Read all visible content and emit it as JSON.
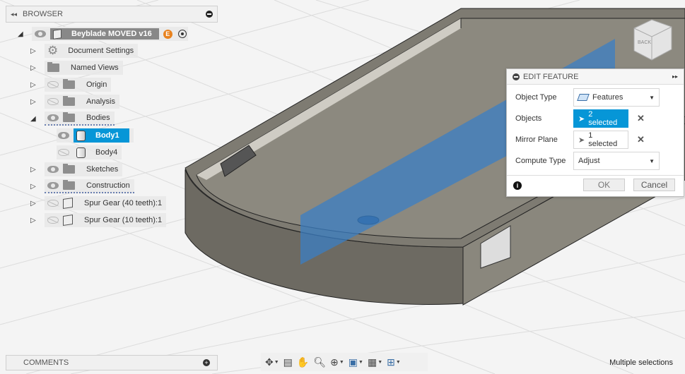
{
  "browser": {
    "title": "BROWSER",
    "root": "Beyblade MOVED v16",
    "root_badge": "E",
    "items": [
      {
        "label": "Document Settings",
        "icon": "gear-icon",
        "visible": null,
        "expander": "collapsed"
      },
      {
        "label": "Named Views",
        "icon": "folder-icon",
        "visible": null,
        "expander": "collapsed"
      },
      {
        "label": "Origin",
        "icon": "folder-icon",
        "visible": false,
        "expander": "collapsed"
      },
      {
        "label": "Analysis",
        "icon": "folder-icon",
        "visible": false,
        "expander": "collapsed"
      },
      {
        "label": "Bodies",
        "icon": "folder-icon",
        "visible": true,
        "expander": "expanded"
      },
      {
        "label": "Body1",
        "icon": "body-icon",
        "visible": true,
        "selected": true
      },
      {
        "label": "Body4",
        "icon": "body-icon",
        "visible": false
      },
      {
        "label": "Sketches",
        "icon": "folder-icon",
        "visible": true,
        "expander": "collapsed"
      },
      {
        "label": "Construction",
        "icon": "folder-icon",
        "visible": true,
        "expander": "collapsed"
      },
      {
        "label": "Spur Gear (40 teeth):1",
        "icon": "component-icon",
        "visible": false,
        "expander": "collapsed"
      },
      {
        "label": "Spur Gear (10 teeth):1",
        "icon": "component-icon",
        "visible": false,
        "expander": "collapsed"
      }
    ]
  },
  "dialog": {
    "title": "EDIT FEATURE",
    "object_type_label": "Object Type",
    "object_type_value": "Features",
    "objects_label": "Objects",
    "objects_value": "2 selected",
    "mirror_plane_label": "Mirror Plane",
    "mirror_plane_value": "1 selected",
    "compute_type_label": "Compute Type",
    "compute_type_value": "Adjust",
    "ok": "OK",
    "cancel": "Cancel"
  },
  "viewcube": {
    "face": "BACK"
  },
  "comments": {
    "title": "COMMENTS"
  },
  "status": "Multiple selections",
  "colors": {
    "accent": "#0696d7",
    "model": "#7a776d",
    "plane": "#3b7fc4"
  }
}
